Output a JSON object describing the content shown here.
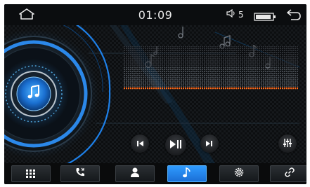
{
  "status_bar": {
    "time": "01:09",
    "volume_level": "5",
    "icons": [
      "home-icon",
      "speaker-icon",
      "battery-icon",
      "back-icon"
    ]
  },
  "player": {
    "album_icon": "music-note-icon",
    "controls": [
      "previous-track-icon",
      "play-pause-icon",
      "next-track-icon",
      "equalizer-icon"
    ]
  },
  "nav": {
    "active_tab": "music",
    "tabs": [
      {
        "name": "apps",
        "icon": "grid-icon"
      },
      {
        "name": "phone",
        "icon": "phone-icon"
      },
      {
        "name": "contacts",
        "icon": "person-icon"
      },
      {
        "name": "music",
        "icon": "music-note-icon"
      },
      {
        "name": "settings",
        "icon": "gear-icon"
      },
      {
        "name": "link",
        "icon": "link-icon"
      }
    ]
  },
  "colors": {
    "accent": "#2f9bff",
    "level_line": "#ff6a1a",
    "background": "#050708"
  }
}
